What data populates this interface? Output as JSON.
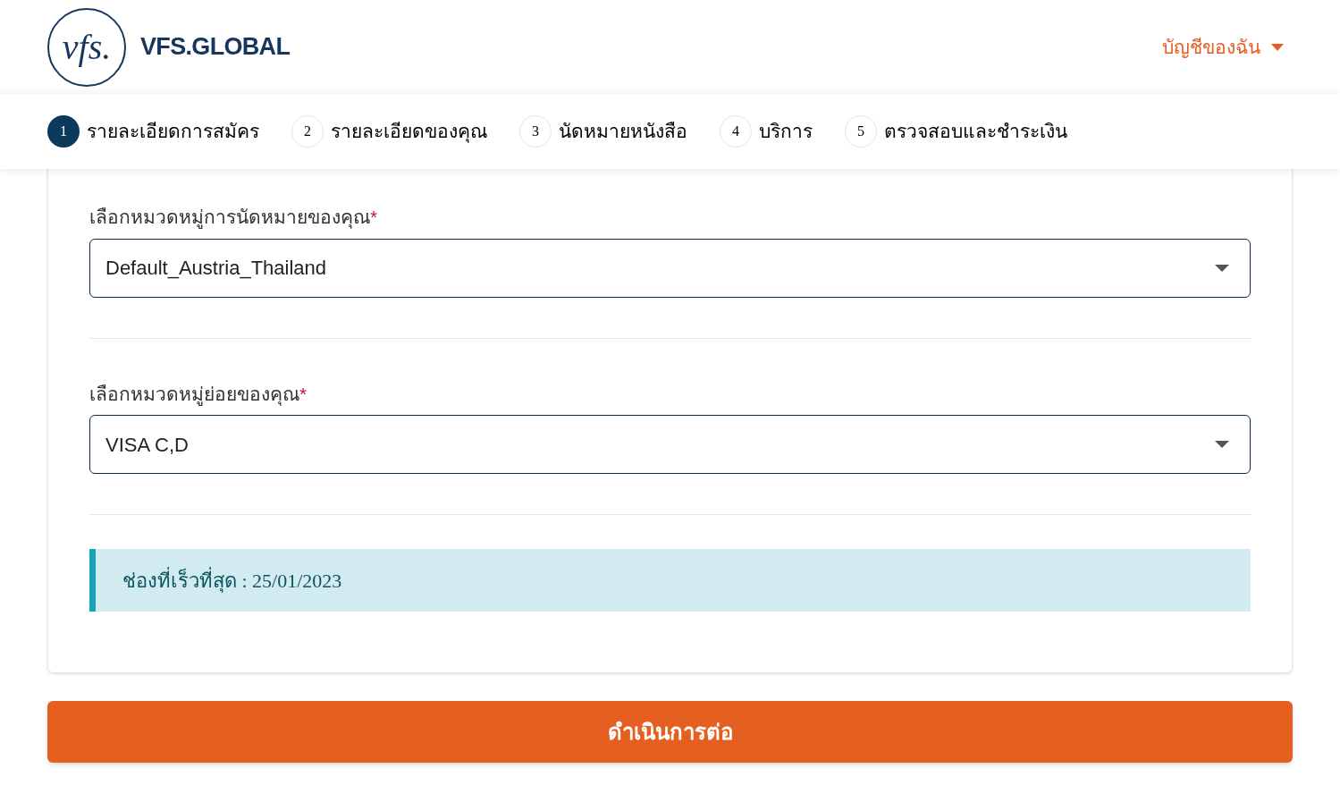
{
  "header": {
    "logo_mark": "vfs.",
    "brand": "VFS.GLOBAL",
    "account_menu": "บัญชีของฉัน"
  },
  "steps": [
    {
      "number": "1",
      "label": "รายละเอียดการสมัคร",
      "selected": true
    },
    {
      "number": "2",
      "label": "รายละเอียดของคุณ",
      "selected": false
    },
    {
      "number": "3",
      "label": "นัดหมายหนังสือ",
      "selected": false
    },
    {
      "number": "4",
      "label": "บริการ",
      "selected": false
    },
    {
      "number": "5",
      "label": "ตรวจสอบและชำระเงิน",
      "selected": false
    }
  ],
  "fields": [
    {
      "label": "เลือกหมวดหมู่การนัดหมายของคุณ",
      "required_mark": "*",
      "value": "Default_Austria_Thailand"
    },
    {
      "label": "เลือกหมวดหมู่ย่อยของคุณ",
      "required_mark": "*",
      "value": "VISA C,D"
    }
  ],
  "alert": "ช่องที่เร็วที่สุด : 25/01/2023",
  "continue_button": "ดำเนินการต่อ"
}
